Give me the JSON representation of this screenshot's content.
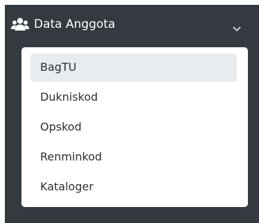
{
  "app": {
    "title": "Data Anggota"
  },
  "sidebar": {
    "section": {
      "label": "Data Anggota",
      "icon": "users-icon",
      "toggle_icon": "chevron-down-icon",
      "expanded": true
    },
    "items": [
      {
        "label": "BagTU",
        "active": true
      },
      {
        "label": "Dukniskod",
        "active": false
      },
      {
        "label": "Opskod",
        "active": false
      },
      {
        "label": "Renminkod",
        "active": false
      },
      {
        "label": "Kataloger",
        "active": false
      }
    ]
  },
  "colors": {
    "sidebar_bg": "#343a40",
    "dropdown_bg": "#ffffff",
    "active_item_bg": "#e9ecef",
    "text_light": "#ffffff",
    "text_dark": "#2b2f33"
  }
}
